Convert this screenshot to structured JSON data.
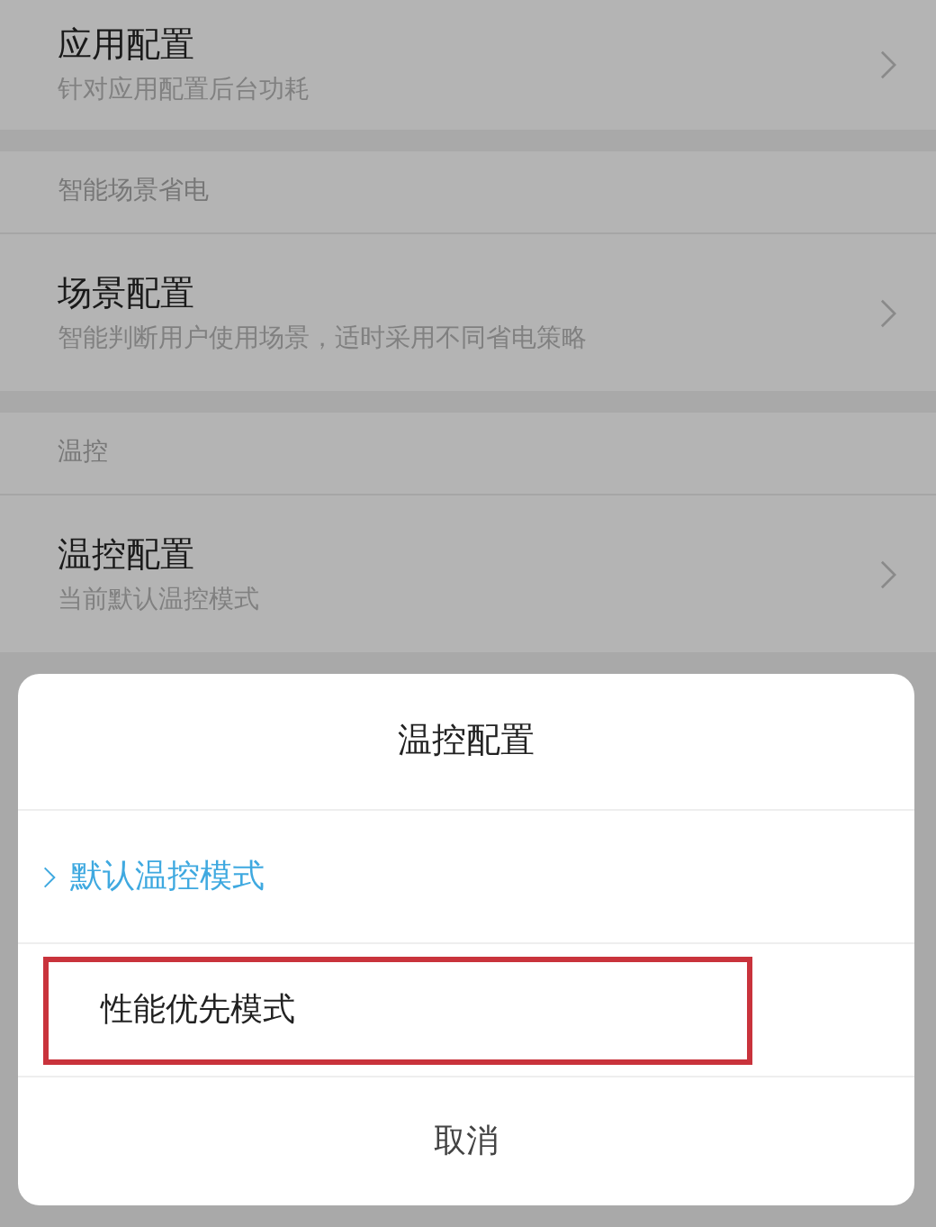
{
  "settings": [
    {
      "kind": "item",
      "title": "应用配置",
      "subtitle": "针对应用配置后台功耗"
    },
    {
      "kind": "header",
      "title": "智能场景省电"
    },
    {
      "kind": "item",
      "title": "场景配置",
      "subtitle": "智能判断用户使用场景，适时采用不同省电策略"
    },
    {
      "kind": "header",
      "title": "温控"
    },
    {
      "kind": "item",
      "title": "温控配置",
      "subtitle": "当前默认温控模式"
    }
  ],
  "dialog": {
    "title": "温控配置",
    "options": [
      {
        "label": "默认温控模式",
        "selected": true,
        "highlighted": false
      },
      {
        "label": "性能优先模式",
        "selected": false,
        "highlighted": true
      }
    ],
    "cancel": "取消"
  }
}
